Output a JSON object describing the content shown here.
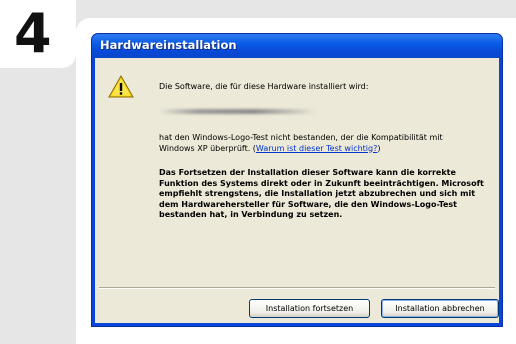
{
  "step": {
    "number": "4"
  },
  "dialog": {
    "title": "Hardwareinstallation",
    "intro": "Die Software, die für diese Hardware installiert wird:",
    "logotest_text": "hat den Windows-Logo-Test nicht bestanden, der die Kompatibilität mit Windows XP überprüft. (",
    "logotest_link": "Warum ist dieser Test wichtig?",
    "logotest_close": ")",
    "warning": "Das Fortsetzen der Installation dieser Software kann die korrekte Funktion des Systems direkt oder in Zukunft beeinträchtigen. Microsoft empfiehlt strengstens, die Installation jetzt abzubrechen und sich mit dem Hardwarehersteller für Software, die den Windows-Logo-Test bestanden hat, in Verbindung zu setzen.",
    "buttons": {
      "continue": "Installation fortsetzen",
      "abort": "Installation abbrechen"
    },
    "icon": "warning-icon"
  },
  "colors": {
    "titlebar": "#0a5be6",
    "client": "#ece9d8",
    "link": "#0033cc"
  }
}
